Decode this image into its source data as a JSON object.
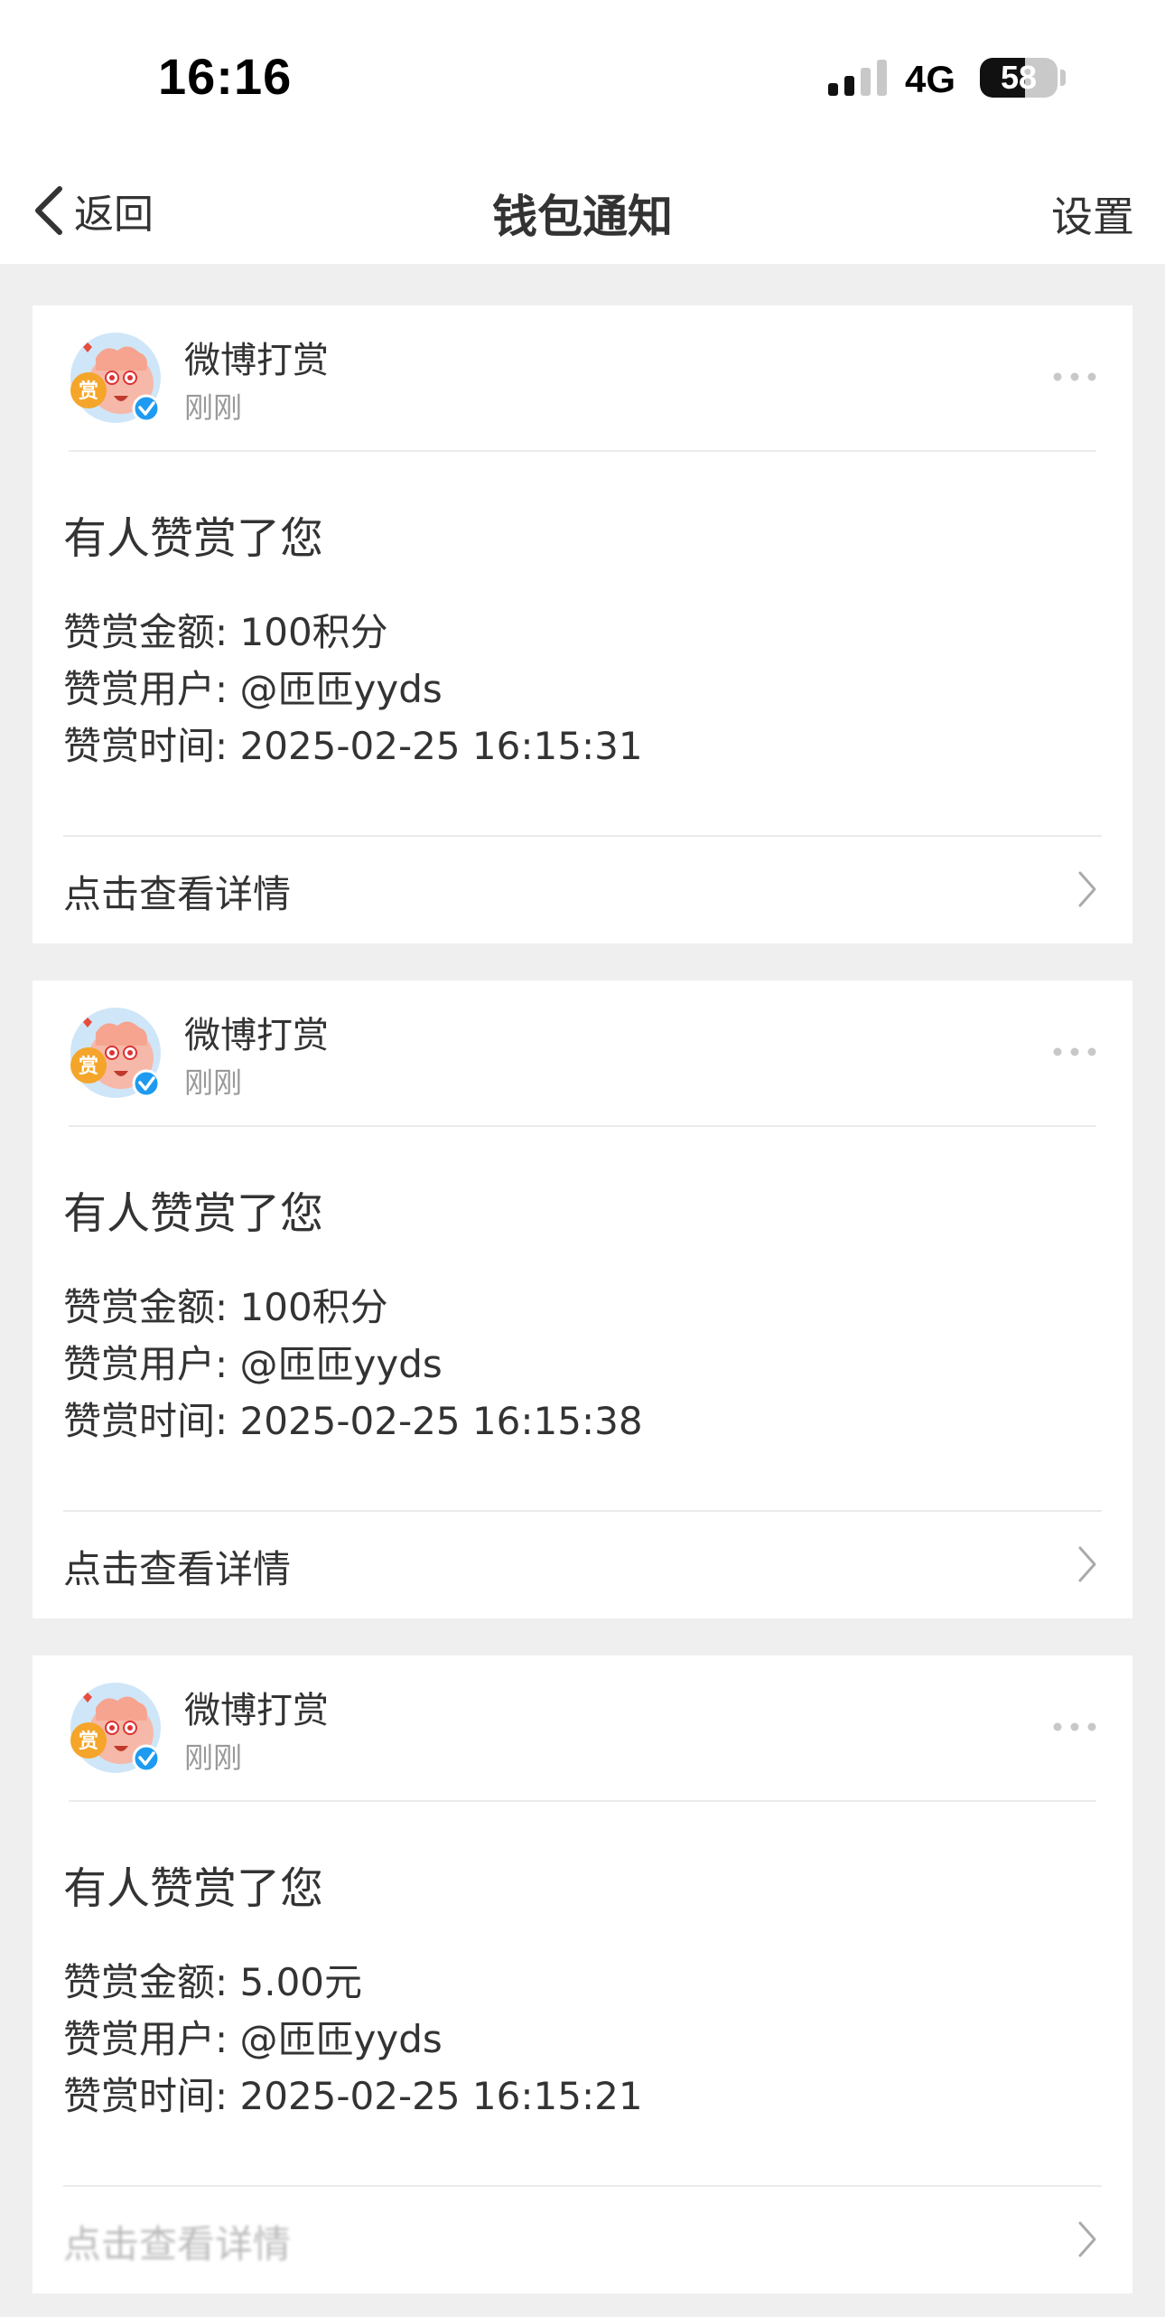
{
  "status_bar": {
    "time": "16:16",
    "network": "4G",
    "battery": "58",
    "battery_level": 0.58
  },
  "nav": {
    "back_label": "返回",
    "title": "钱包通知",
    "settings_label": "设置"
  },
  "colors": {
    "background": "#efefef",
    "card": "#ffffff",
    "text": "#333333",
    "muted": "#999999",
    "verified_badge": "#1e9bf0"
  },
  "icons": {
    "avatar": "weibo-reward-mascot-avatar",
    "verified": "verified-badge-icon",
    "more": "more-dots-icon",
    "chevron": "chevron-right-icon"
  },
  "notifications": [
    {
      "sender": "微博打赏",
      "time": "刚刚",
      "title": "有人赞赏了您",
      "lines": [
        "赞赏金额: 100积分",
        "赞赏用户: @匝匝yyds",
        "赞赏时间: 2025-02-25 16:15:31"
      ],
      "action": "点击查看详情"
    },
    {
      "sender": "微博打赏",
      "time": "刚刚",
      "title": "有人赞赏了您",
      "lines": [
        "赞赏金额: 100积分",
        "赞赏用户: @匝匝yyds",
        "赞赏时间: 2025-02-25 16:15:38"
      ],
      "action": "点击查看详情"
    },
    {
      "sender": "微博打赏",
      "time": "刚刚",
      "title": "有人赞赏了您",
      "lines": [
        "赞赏金额: 5.00元",
        "赞赏用户: @匝匝yyds",
        "赞赏时间: 2025-02-25 16:15:21"
      ],
      "action": "点击查看详情"
    }
  ]
}
